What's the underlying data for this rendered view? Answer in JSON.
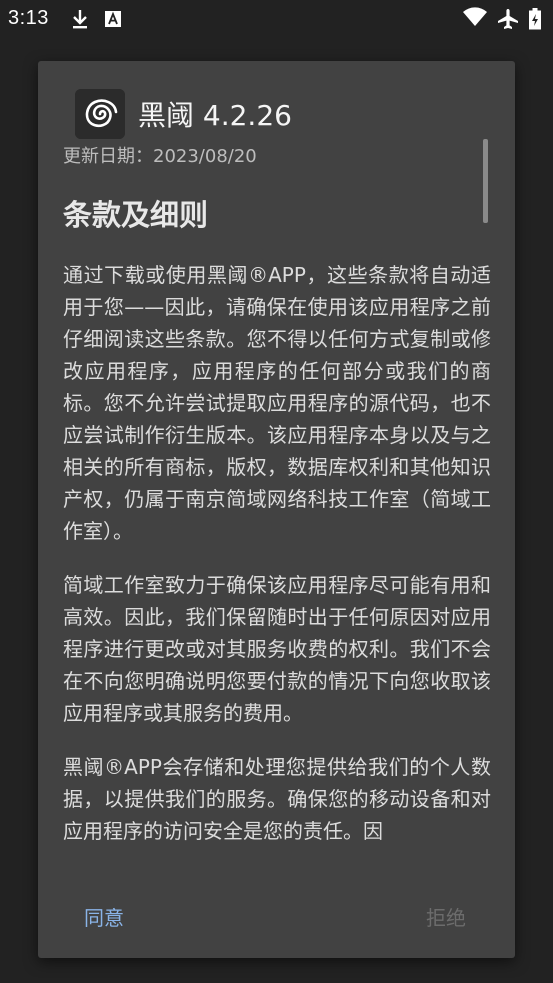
{
  "status_bar": {
    "time": "3:13",
    "left_icons": [
      "download-icon",
      "a-text-icon"
    ],
    "right_icons": [
      "wifi-icon",
      "airplane-icon",
      "battery-icon"
    ]
  },
  "dialog": {
    "app_name_version": "黑阈 4.2.26",
    "update_date": "更新日期：2023/08/20",
    "heading": "条款及细则",
    "paragraphs": [
      "通过下载或使用黑阈®APP，这些条款将自动适用于您——因此，请确保在使用该应用程序之前仔细阅读这些条款。您不得以任何方式复制或修改应用程序，应用程序的任何部分或我们的商标。您不允许尝试提取应用程序的源代码，也不应尝试制作衍生版本。该应用程序本身以及与之相关的所有商标，版权，数据库权利和其他知识产权，仍属于南京简域网络科技工作室（简域工作室）。",
      "简域工作室致力于确保该应用程序尽可能有用和高效。因此，我们保留随时出于任何原因对应用程序进行更改或对其服务收费的权利。我们不会在不向您明确说明您要付款的情况下向您收取该应用程序或其服务的费用。",
      "黑阈®APP会存储和处理您提供给我们的个人数据，以提供我们的服务。确保您的移动设备和对应用程序的访问安全是您的责任。因"
    ],
    "agree_label": "同意",
    "reject_label": "拒绝"
  },
  "colors": {
    "background": "#222222",
    "dialog": "#424242",
    "accent": "#8ab4e8",
    "disabled": "#6c6c6c"
  }
}
